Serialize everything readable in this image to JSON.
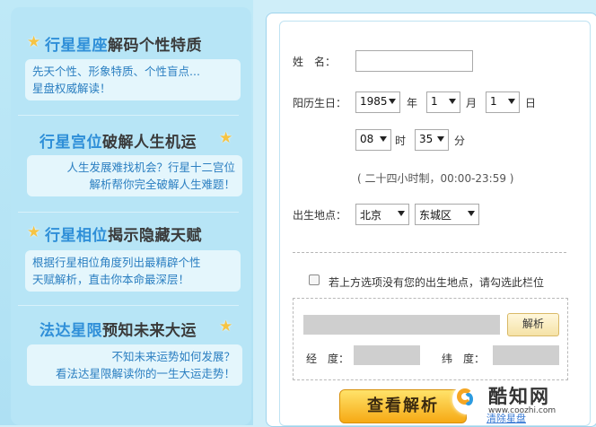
{
  "features": [
    {
      "title_highlight": "行星星座",
      "title_rest": "解码个性特质",
      "lines": [
        "先天个性、形象特质、个性盲点...",
        "星盘权威解读！"
      ]
    },
    {
      "title_highlight": "行星宫位",
      "title_rest": "破解人生机运",
      "lines": [
        "人生发展难找机会？行星十二宫位",
        "解析帮你完全破解人生难题！"
      ]
    },
    {
      "title_highlight": "行星相位",
      "title_rest": "揭示隐藏天赋",
      "lines": [
        "根据行星相位角度列出最精辟个性",
        "天赋解析，直击你本命最深层！"
      ]
    },
    {
      "title_highlight": "法达星限",
      "title_rest": "预知未来大运",
      "lines": [
        "不知未来运势如何发展？",
        "看法达星限解读你的一生大运走势！"
      ]
    }
  ],
  "form": {
    "name_label": "姓　名：",
    "name_value": "",
    "birthdate_label": "阳历生日：",
    "year_value": "1985",
    "year_unit": "年",
    "month_value": "1",
    "month_unit": "月",
    "day_value": "1",
    "day_unit": "日",
    "hour_value": "08",
    "hour_unit": "时",
    "minute_value": "35",
    "minute_unit": "分",
    "time_hint": "( 二十四小时制，00:00-23:59 )",
    "place_label": "出生地点：",
    "city_value": "北京",
    "district_value": "东城区",
    "no_location_label": "若上方选项没有您的出生地点，请勾选此栏位",
    "location_input_value": "",
    "parse_label": "解析",
    "longitude_label": "经　度：",
    "latitude_label": "纬　度：",
    "submit_label": "查看解析",
    "link_label": "清除星盘"
  },
  "watermark": {
    "brand": "酷知网",
    "url": "www.coozhi.com"
  },
  "colors": {
    "highlight": "#2f8fd8",
    "desc_text": "#2b7fc1",
    "submit": "#f6a914"
  }
}
